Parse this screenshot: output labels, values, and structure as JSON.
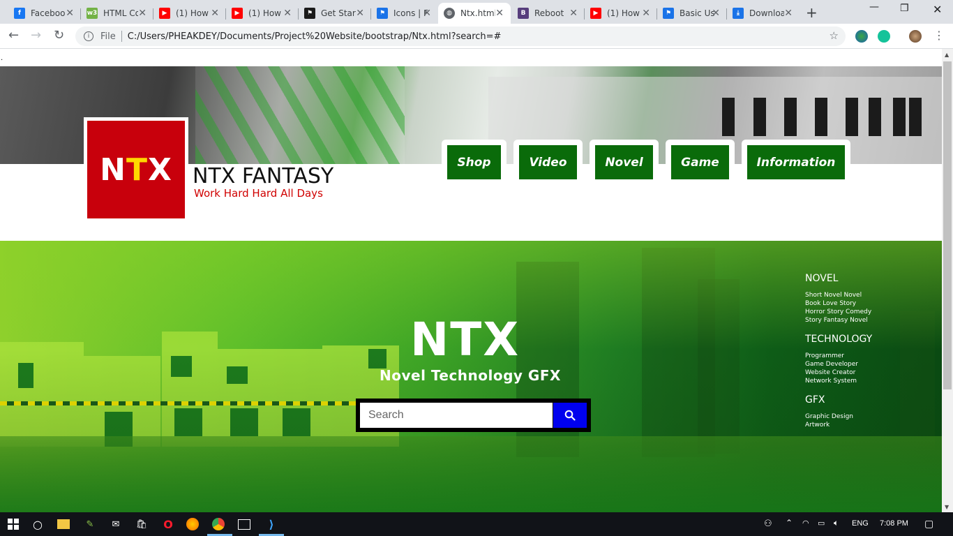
{
  "browser": {
    "tabs": [
      {
        "title": "Facebook",
        "icon": "facebook-icon",
        "color": "#1877f2",
        "glyph": "f"
      },
      {
        "title": "HTML Color",
        "icon": "html-color-icon",
        "color": "#73b246",
        "glyph": "w3"
      },
      {
        "title": "(1) How",
        "icon": "youtube-icon",
        "color": "#ff0000",
        "glyph": "▶"
      },
      {
        "title": "(1) How",
        "icon": "youtube-icon",
        "color": "#ff0000",
        "glyph": "▶"
      },
      {
        "title": "Get Started",
        "icon": "fontawesome-flag-icon",
        "color": "#1a1a1a",
        "glyph": "⚑"
      },
      {
        "title": "Icons | Font",
        "icon": "fontawesome-flag-icon",
        "color": "#1a73e8",
        "glyph": "⚑"
      },
      {
        "title": "Ntx.html",
        "icon": "globe-icon",
        "color": "#5f6368",
        "glyph": "◍"
      },
      {
        "title": "Reboot",
        "icon": "bootstrap-icon",
        "color": "#563d7c",
        "glyph": "B"
      },
      {
        "title": "(1) How",
        "icon": "youtube-icon",
        "color": "#ff0000",
        "glyph": "▶"
      },
      {
        "title": "Basic Use",
        "icon": "fontawesome-flag-icon",
        "color": "#1a73e8",
        "glyph": "⚑"
      },
      {
        "title": "Download",
        "icon": "download-icon",
        "color": "#1a73e8",
        "glyph": "⤓"
      }
    ],
    "address": {
      "scheme": "File",
      "url": "C:/Users/PHEAKDEY/Documents/Project%20Website/bootstrap/Ntx.html?search=#"
    }
  },
  "page": {
    "dot": ".",
    "logo_text_a": "N",
    "logo_text_b": "T",
    "logo_text_c": "X",
    "site_title": "NTX FANTASY",
    "tagline": "Work Hard Hard All Days",
    "nav": [
      "Shop",
      "Video",
      "Novel",
      "Game",
      "Information"
    ],
    "hero_title": "NTX",
    "hero_subtitle": "Novel Technology GFX",
    "search_placeholder": "Search",
    "sidebar": [
      {
        "heading": "NOVEL",
        "items": [
          "Short Novel Novel",
          "Book Love Story",
          "Horror Story Comedy",
          "Story Fantasy Novel"
        ]
      },
      {
        "heading": "TECHNOLOGY",
        "items": [
          "Programmer",
          "Game Developer",
          "Website Creator",
          "Network System"
        ]
      },
      {
        "heading": "GFX",
        "items": [
          "Graphic Design",
          "Artwork"
        ]
      }
    ]
  },
  "taskbar": {
    "language": "ENG",
    "time": "7:08 PM"
  },
  "colors": {
    "nav_green": "#0a6b0a",
    "logo_red": "#c8000c",
    "search_button": "#0000ee",
    "tagline_red": "#d00000"
  }
}
